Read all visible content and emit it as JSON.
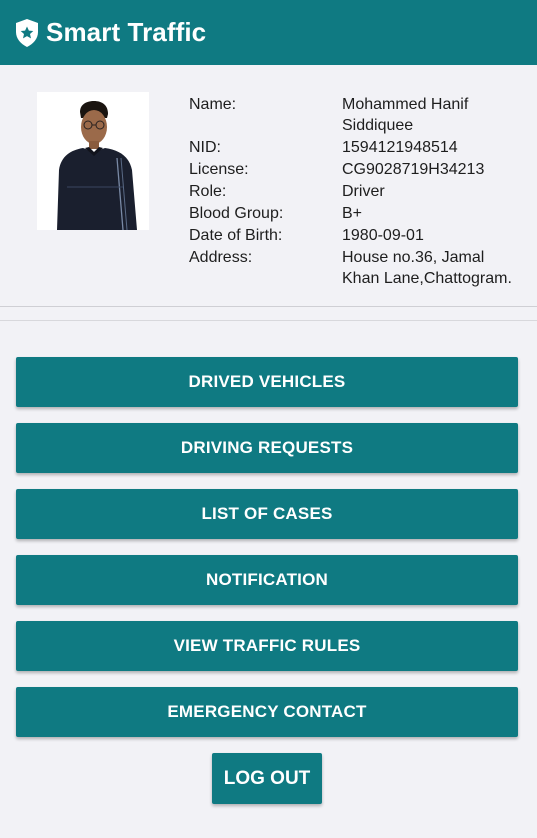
{
  "app": {
    "title": "Smart Traffic",
    "logo_icon": "shield-star-icon",
    "accent_color": "#0f7a82"
  },
  "profile": {
    "photo_icon": "avatar",
    "fields": [
      {
        "label": "Name:",
        "value": "Mohammed Hanif Siddiquee"
      },
      {
        "label": "NID:",
        "value": "1594121948514"
      },
      {
        "label": "License:",
        "value": "CG9028719H34213"
      },
      {
        "label": "Role:",
        "value": "Driver"
      },
      {
        "label": "Blood Group:",
        "value": "B+"
      },
      {
        "label": "Date of Birth:",
        "value": "1980-09-01"
      },
      {
        "label": "Address:",
        "value": "House no.36, Jamal Khan Lane,Chattogram."
      }
    ]
  },
  "menu": {
    "driven_vehicles": "DRIVED VEHICLES",
    "driving_requests": "DRIVING REQUESTS",
    "list_of_cases": "LIST OF CASES",
    "notification": "NOTIFICATION",
    "view_traffic_rules": "VIEW TRAFFIC RULES",
    "emergency_contact": "EMERGENCY CONTACT",
    "logout": "LOG OUT"
  }
}
